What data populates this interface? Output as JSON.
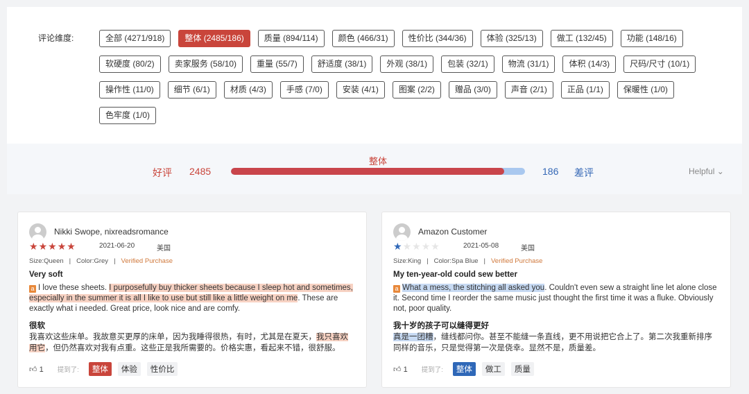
{
  "dimensions": {
    "label": "评论维度:",
    "rows": [
      [
        "全部 (4271/918)",
        "整体 (2485/186)",
        "质量 (894/114)",
        "颜色 (466/31)",
        "性价比 (344/36)",
        "体验 (325/13)",
        "做工 (132/45)",
        "功能 (148/16)"
      ],
      [
        "软硬度 (80/2)",
        "卖家服务 (58/10)",
        "重量 (55/7)",
        "舒适度 (38/1)",
        "外观 (38/1)",
        "包装 (32/1)",
        "物流 (31/1)",
        "体积 (14/3)",
        "尺码/尺寸 (10/1)"
      ],
      [
        "操作性 (11/0)",
        "细节 (6/1)",
        "材质 (4/3)",
        "手感 (7/0)",
        "安装 (4/1)",
        "图案 (2/2)",
        "赠品 (3/0)",
        "声音 (2/1)",
        "正品 (1/1)",
        "保暖性 (1/0)"
      ],
      [
        "色牢度 (1/0)"
      ]
    ],
    "active": "整体 (2485/186)"
  },
  "summary": {
    "good_label": "好评",
    "good_count": "2485",
    "dimension": "整体",
    "bad_count": "186",
    "bad_label": "差评",
    "good_fraction": 0.93,
    "sort": "Helpful"
  },
  "colors": {
    "accent_red": "#c9453b",
    "accent_blue": "#2f68b8"
  },
  "reviews": [
    {
      "name": "Nikki Swope, nixreadsromance",
      "rating": 5,
      "date": "2021-06-20",
      "country": "美国",
      "size": "Size:Queen",
      "color": "Color:Grey",
      "verified": "Verified Purchase",
      "title": "Very soft",
      "body_pre": "I love these sheets. ",
      "body_hl": "I purposefully buy thicker sheets because I sleep hot and sometimes, especially in the summer it is all I like to use but still like a little weight on me",
      "body_post": ". These are exactly what i needed. Great price, look nice and are comfy.",
      "zh_title": "很软",
      "zh_pre": "我喜欢这些床单。我故意买更厚的床单，因为我睡得很热，有时，尤其是在夏天，",
      "zh_hl": "我只喜欢用它",
      "zh_post": "，但仍然喜欢对我有点重。这些正是我所需要的。价格实惠，看起来不错，很舒服。",
      "likes": "1",
      "mentioned": "提到了:",
      "tags": [
        "整体",
        "体验",
        "性价比"
      ]
    },
    {
      "name": "Amazon Customer",
      "rating": 1,
      "date": "2021-05-08",
      "country": "美国",
      "size": "Size:King",
      "color": "Color:Spa Blue",
      "verified": "Verified Purchase",
      "title": "My ten-year-old could sew better",
      "body_pre": "",
      "body_hl": "What a mess, the stitching all asked you",
      "body_post": ". Couldn't even sew a straight line let alone close it. Second time I reorder the same music just thought the first time it was a fluke. Obviously not, poor quality.",
      "zh_title": "我十岁的孩子可以缝得更好",
      "zh_pre": "",
      "zh_hl": "真是一团糟",
      "zh_post": "，缝线都问你。甚至不能缝一条直线，更不用说把它合上了。第二次我重新排序同样的音乐，只是觉得第一次是侥幸。显然不是，质量差。",
      "likes": "1",
      "mentioned": "提到了:",
      "tags": [
        "整体",
        "做工",
        "质量"
      ]
    }
  ]
}
